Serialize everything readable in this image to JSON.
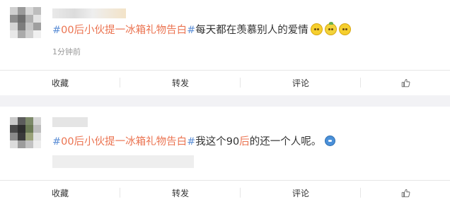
{
  "posts": [
    {
      "tag_hash_open": "#",
      "tag_text": "00后小伙提一冰箱礼物告白",
      "tag_hash_close": "#",
      "body": "每天都在羡慕别人的爱情",
      "emojis": [
        "lemon-emoji",
        "lemon-emoji",
        "lemon-emoji"
      ],
      "time": "1分钟前",
      "actions": {
        "favorite": "收藏",
        "repost": "转发",
        "comment": "评论"
      }
    },
    {
      "tag_hash_open": "#",
      "tag_text": "00后小伙提一冰箱礼物告白",
      "tag_hash_close": "#",
      "body_before": "我这个90",
      "body_highlight": "后",
      "body_after": "的还一个人呢。",
      "emojis": [
        "blue-face-emoji"
      ],
      "actions": {
        "favorite": "收藏",
        "repost": "转发",
        "comment": "评论"
      }
    }
  ],
  "colors": {
    "hashtag_symbol": "#5d8fd6",
    "hashtag_text": "#eb7350",
    "time_text": "#999999",
    "separator_bg": "#f2f2f5"
  },
  "icons": {
    "like": "thumb-up-icon"
  }
}
